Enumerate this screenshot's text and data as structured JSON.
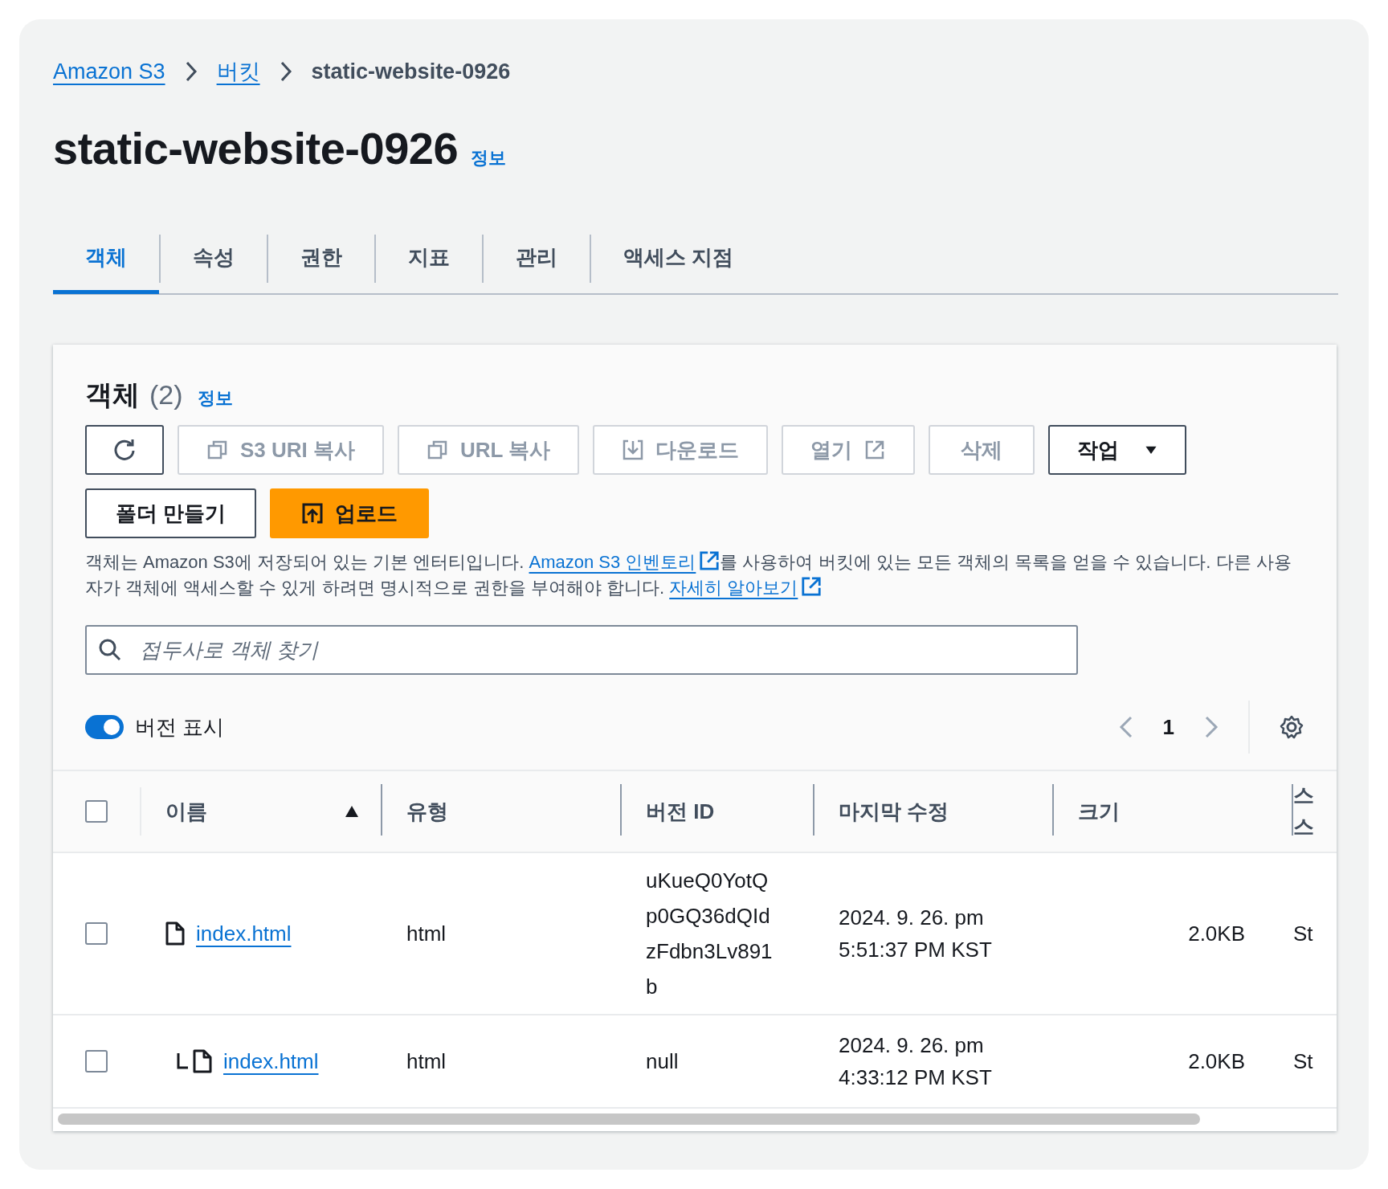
{
  "breadcrumbs": [
    {
      "label": "Amazon S3",
      "link": true
    },
    {
      "label": "버킷",
      "link": true
    },
    {
      "label": "static-website-0926",
      "link": false
    }
  ],
  "title": "static-website-0926",
  "title_info": "정보",
  "tabs": [
    {
      "label": "객체",
      "selected": true
    },
    {
      "label": "속성",
      "selected": false
    },
    {
      "label": "권한",
      "selected": false
    },
    {
      "label": "지표",
      "selected": false
    },
    {
      "label": "관리",
      "selected": false
    },
    {
      "label": "액세스 지점",
      "selected": false
    }
  ],
  "objects": {
    "title": "객체",
    "count": "(2)",
    "info": "정보",
    "toolbar": [
      {
        "kind": "refresh",
        "disabled": false
      },
      {
        "kind": "copy",
        "label": "S3 URI 복사",
        "disabled": true
      },
      {
        "kind": "copy",
        "label": "URL 복사",
        "disabled": true
      },
      {
        "kind": "download",
        "label": "다운로드",
        "disabled": true
      },
      {
        "kind": "external",
        "label": "열기",
        "disabled": true
      },
      {
        "kind": "plain",
        "label": "삭제",
        "disabled": true
      },
      {
        "kind": "dropdown",
        "label": "작업",
        "disabled": false
      },
      {
        "kind": "plain",
        "label": "폴더 만들기",
        "disabled": false
      },
      {
        "kind": "upload",
        "label": "업로드",
        "disabled": false
      }
    ],
    "description": [
      {
        "kind": "text",
        "text": "객체는 Amazon S3에 저장되어 있는 기본 엔터티입니다. "
      },
      {
        "kind": "link",
        "text": "Amazon S3 인벤토리"
      },
      {
        "kind": "text",
        "text": "를 사용하여 버킷에 있는 모든 객체의 목록을 얻을 수 있습니다. 다른 사용자가 객체에 액세스할 수 있게 하려면 명시적으로 권한을 부여해야 합니다. "
      },
      {
        "kind": "link",
        "text": "자세히 알아보기"
      }
    ],
    "search": {
      "placeholder": "접두사로 객체 찾기"
    },
    "show_versions": {
      "label": "버전 표시",
      "on": true
    },
    "page": "1",
    "table": {
      "columns": [
        {
          "label": "이름",
          "sort_ascending": true
        },
        {
          "label": "유형"
        },
        {
          "label": "버전 ID"
        },
        {
          "label": "마지막 수정"
        },
        {
          "label": "크기"
        },
        {
          "label": "스 스"
        }
      ],
      "all_checked": false,
      "rows": [
        {
          "checked": false,
          "name": "index.html",
          "type": "html",
          "version_id": "uKueQ0YotQp0GQ36dQIdzFdbn3Lv891b",
          "modified": "2024. 9. 26. pm 5:51:37 PM KST",
          "size": "2.0KB",
          "column_6": "St",
          "children": [
            {
              "checked": false,
              "name": "index.html",
              "type": "html",
              "version_id": "null",
              "modified": "2024. 9. 26. pm 4:33:12 PM KST",
              "size": "2.0KB",
              "column_6": "St"
            }
          ]
        }
      ]
    }
  }
}
